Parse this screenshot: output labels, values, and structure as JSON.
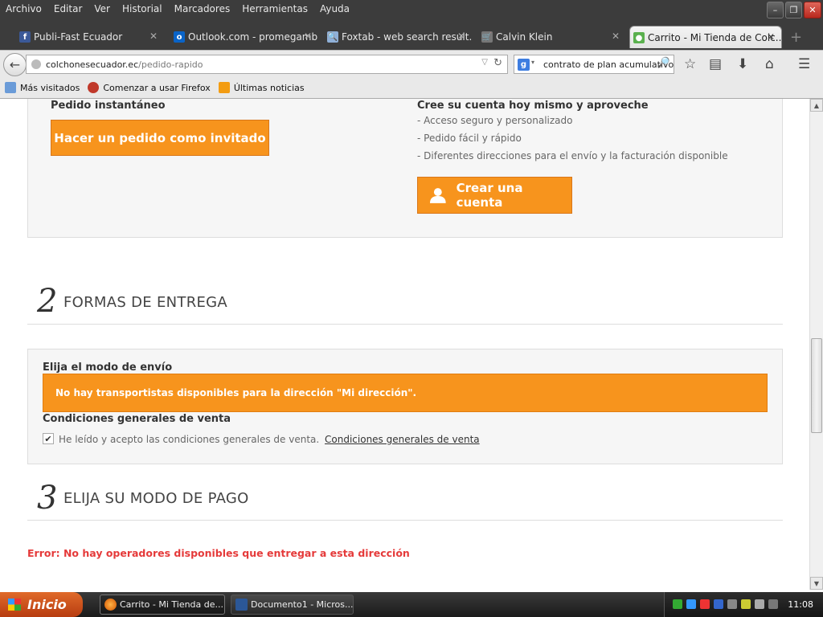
{
  "menu": [
    "Archivo",
    "Editar",
    "Ver",
    "Historial",
    "Marcadores",
    "Herramientas",
    "Ayuda"
  ],
  "tabs": [
    {
      "label": "Publi-Fast Ecuador",
      "icon": "facebook-icon"
    },
    {
      "label": "Outlook.com - promegamb...",
      "icon": "outlook-icon"
    },
    {
      "label": "Foxtab - web search result...",
      "icon": "search-icon"
    },
    {
      "label": "Calvin Klein",
      "icon": "cart-icon"
    },
    {
      "label": "Carrito - Mi Tienda de Colc...",
      "icon": "store-icon",
      "active": true
    }
  ],
  "address": {
    "domain": "colchonesecuador.ec",
    "path": "/pedido-rapido"
  },
  "search": {
    "value": "contrato de plan  acumulativo"
  },
  "bookmarks": [
    "Más visitados",
    "Comenzar a usar Firefox",
    "Últimas noticias"
  ],
  "page": {
    "instant_title": "Pedido instantáneo",
    "guest_button": "Hacer un pedido como invitado",
    "account_title": "Cree su cuenta hoy mismo y aproveche",
    "benefits": [
      "- Acceso seguro y personalizado",
      "- Pedido fácil y rápido",
      "- Diferentes direcciones para el envío y la facturación disponible"
    ],
    "create_button": "Crear una cuenta",
    "step2": {
      "number": "2",
      "title": "FORMAS DE ENTREGA"
    },
    "shipping_label": "Elija el modo de envío",
    "shipping_alert": "No hay transportistas disponibles para la dirección \"Mi dirección\".",
    "terms_title": "Condiciones generales de venta",
    "terms_text": "He leído y acepto las condiciones generales de venta.",
    "terms_link": "Condiciones generales de venta",
    "step3": {
      "number": "3",
      "title": "ELIJA SU MODO DE PAGO"
    },
    "error": "Error: No hay operadores disponibles que entregar a esta dirección"
  },
  "taskbar": {
    "start": "Inicio",
    "windows": [
      {
        "label": "Carrito - Mi Tienda de..."
      },
      {
        "label": "Documento1 - Micros..."
      }
    ],
    "clock": "11:08"
  },
  "colors": {
    "accent": "#f7941d",
    "error": "#e53a3a"
  }
}
